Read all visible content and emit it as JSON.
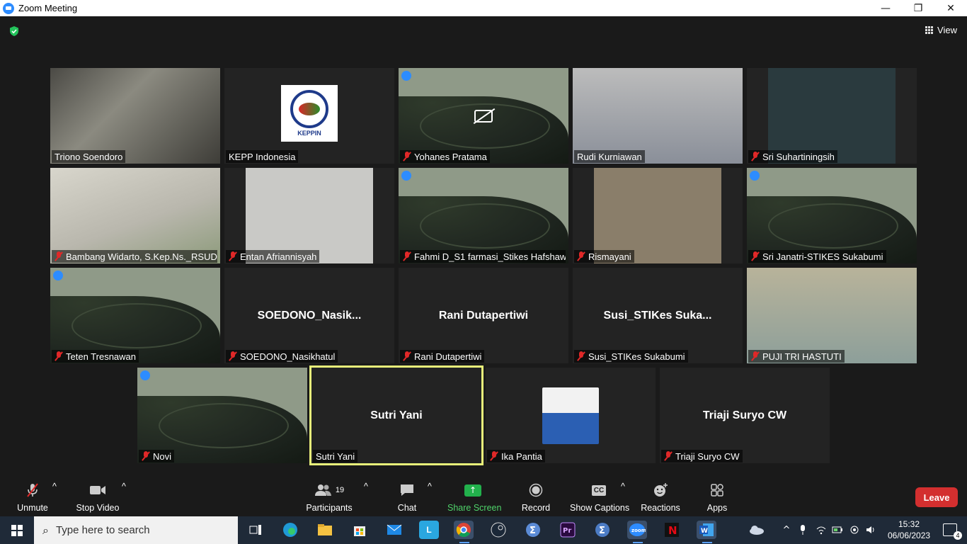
{
  "window": {
    "title": "Zoom Meeting",
    "minimize": "—",
    "restore": "❐",
    "close": "✕"
  },
  "topbar": {
    "view_label": "View"
  },
  "tiles": [
    {
      "name": "Triono Soendoro",
      "muted": false
    },
    {
      "name": "KEPP Indonesia",
      "muted": false,
      "logo_text": "KEPPIN"
    },
    {
      "name": "Yohanes Pratama",
      "muted": true
    },
    {
      "name": "Rudi Kurniawan",
      "muted": false
    },
    {
      "name": "Sri Suhartiningsih",
      "muted": true
    },
    {
      "name": "Bambang Widarto, S.Kep.Ns._RSUD...",
      "muted": true
    },
    {
      "name": "Entan Afriannisyah",
      "muted": true
    },
    {
      "name": "Fahmi D_S1 farmasi_Stikes Hafshaw...",
      "muted": true
    },
    {
      "name": "Rismayani",
      "muted": true
    },
    {
      "name": "Sri Janatri-STIKES Sukabumi",
      "muted": true
    },
    {
      "name": "Teten Tresnawan",
      "muted": true
    },
    {
      "name": "SOEDONO_Nasikhatul",
      "muted": true,
      "big": "SOEDONO_Nasik..."
    },
    {
      "name": "Rani Dutapertiwi",
      "muted": true,
      "big": "Rani Dutapertiwi"
    },
    {
      "name": "Susi_STIKes Sukabumi",
      "muted": true,
      "big": "Susi_STIKes  Suka..."
    },
    {
      "name": "PUJI TRI HASTUTI",
      "muted": true
    },
    {
      "name": "Novi",
      "muted": true
    },
    {
      "name": "Sutri Yani",
      "muted": false,
      "big": "Sutri Yani",
      "active": true
    },
    {
      "name": "Ika Pantia",
      "muted": true
    },
    {
      "name": "Triaji Suryo CW",
      "muted": true,
      "big": "Triaji Suryo CW"
    }
  ],
  "toolbar": {
    "unmute": "Unmute",
    "stop_video": "Stop Video",
    "participants": "Participants",
    "participants_count": "19",
    "chat": "Chat",
    "share_screen": "Share Screen",
    "record": "Record",
    "show_captions": "Show Captions",
    "cc": "CC",
    "reactions": "Reactions",
    "apps": "Apps",
    "leave": "Leave"
  },
  "taskbar": {
    "search_placeholder": "Type here to search",
    "time": "15:32",
    "date": "06/06/2023",
    "notification_count": "4"
  },
  "colors": {
    "accent": "#2d8cff",
    "leave": "#d32f2f",
    "share": "#22b14c",
    "active_border": "#e8f27a",
    "muted": "#e02828"
  }
}
